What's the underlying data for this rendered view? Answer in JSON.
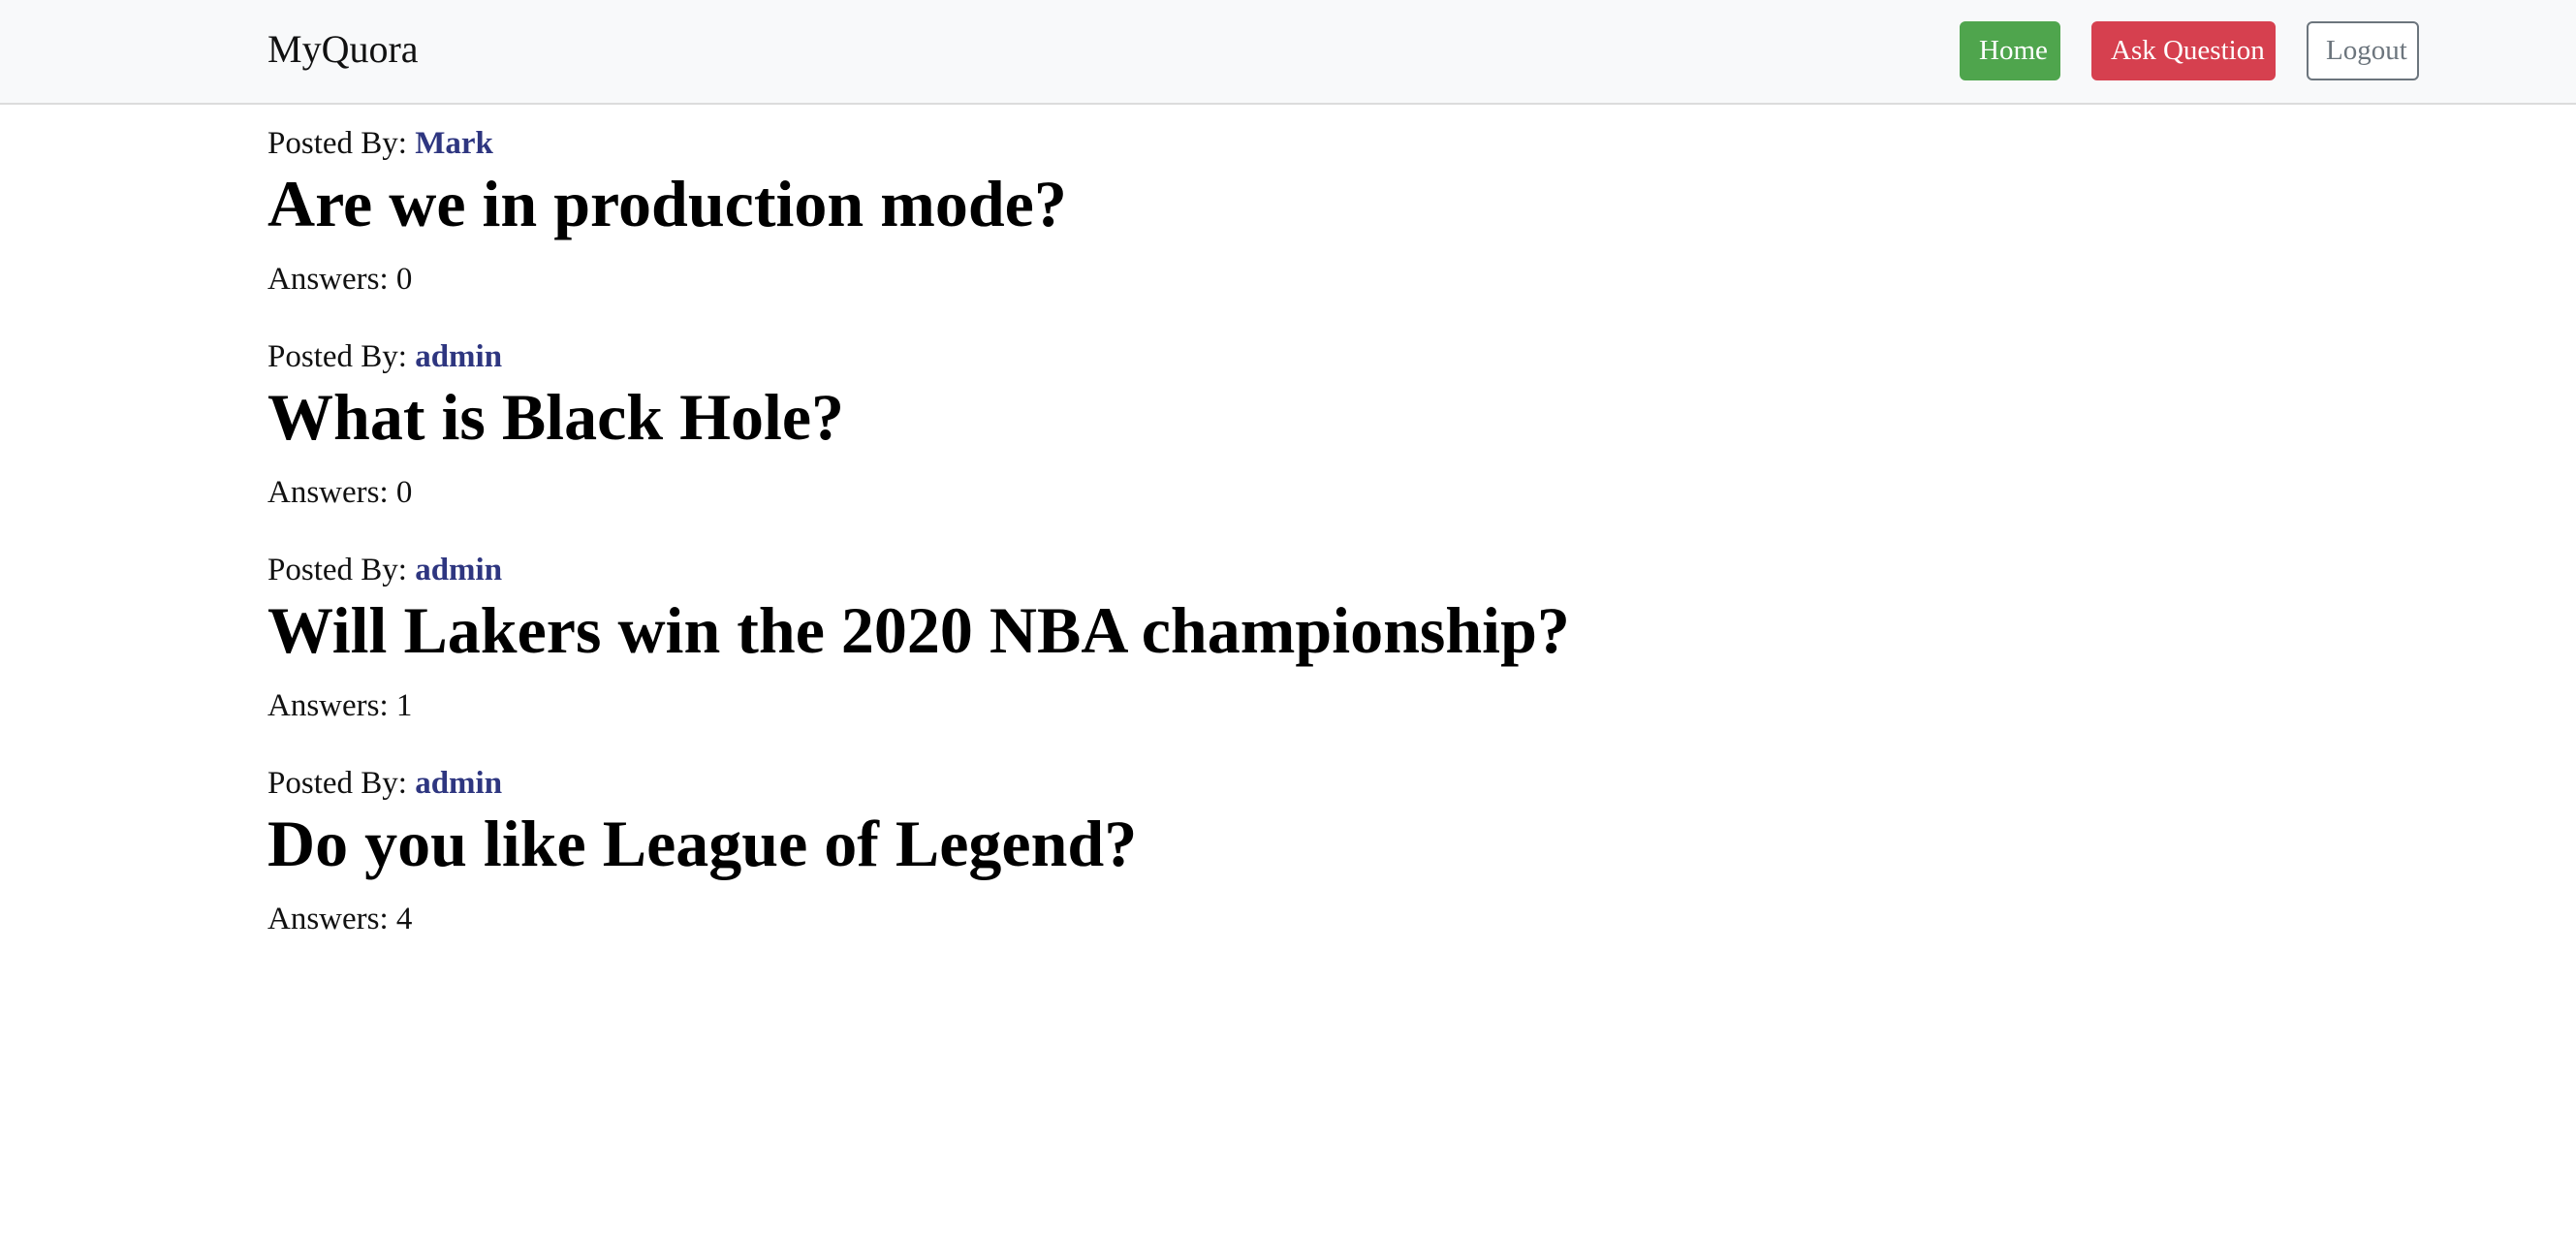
{
  "navbar": {
    "brand": "MyQuora",
    "home_label": "Home",
    "ask_label": "Ask Question",
    "logout_label": "Logout",
    "colors": {
      "home": "#4fa54d",
      "ask": "#d6404f",
      "logout_border": "#6c757d",
      "author_link": "#2e3680"
    }
  },
  "posted_by_prefix": "Posted By: ",
  "answers_prefix": "Answers: ",
  "questions": [
    {
      "author": "Mark",
      "title": "Are we in production mode?",
      "answers": "0"
    },
    {
      "author": "admin",
      "title": "What is Black Hole?",
      "answers": "0"
    },
    {
      "author": "admin",
      "title": "Will Lakers win the 2020 NBA championship?",
      "answers": "1"
    },
    {
      "author": "admin",
      "title": "Do you like League of Legend?",
      "answers": "4"
    }
  ]
}
